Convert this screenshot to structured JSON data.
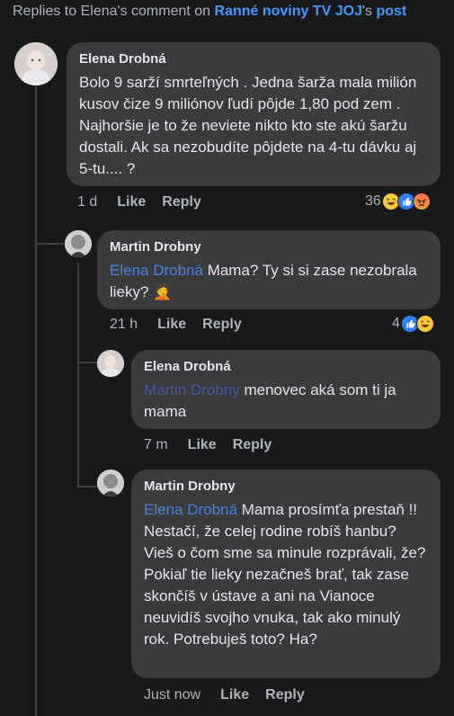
{
  "header": {
    "prefix": "Replies to Elena's comment on ",
    "page": "Ranné noviny TV JOJ",
    "possessive": "'s ",
    "post": "post"
  },
  "comments": [
    {
      "author": "Elena Drobná",
      "text": "Bolo 9 sarží smrteľných . Jedna šarža mala milión kusov čize 9 miliónov ľudí pôjde 1,80 pod zem . Najhoršie je to že neviete nikto kto ste akú šaržu dostali. Ak sa nezobudíte pôjdete na 4-tu dávku aj 5-tu.... ?",
      "time": "1 d",
      "like": "Like",
      "reply": "Reply",
      "reaction_count": "36",
      "reactions": [
        "haha",
        "like",
        "angry"
      ]
    },
    {
      "author": "Martin Drobny",
      "mention": "Elena Drobná",
      "text": " Mama? Ty si si zase nezobrala lieky? 🤦",
      "time": "21 h",
      "like": "Like",
      "reply": "Reply",
      "reaction_count": "4",
      "reactions": [
        "like",
        "haha"
      ]
    },
    {
      "author": "Elena Drobná",
      "mention": "Martin Drobny",
      "text": " menovec aká som ti ja mama",
      "time": "7 m",
      "like": "Like",
      "reply": "Reply"
    },
    {
      "author": "Martin Drobny",
      "mention": "Elena Drobná",
      "text": " Mama prosímťa prestaň !! Nestačí, že celej rodine robíš hanbu? Vieš o čom sme sa minule rozprávali, že? Pokiaľ tie lieky nezačneš brať, tak zase skončíš v ústave a ani na Vianoce neuvidíš svojho vnuka, tak ako minulý rok. Potrebuješ toto? Ha?",
      "time": "Just now",
      "like": "Like",
      "reply": "Reply"
    }
  ],
  "colors": {
    "background": "#18191a",
    "bubble": "#3a3b3c",
    "link": "#4599ff",
    "mention": "#4a82dd"
  }
}
